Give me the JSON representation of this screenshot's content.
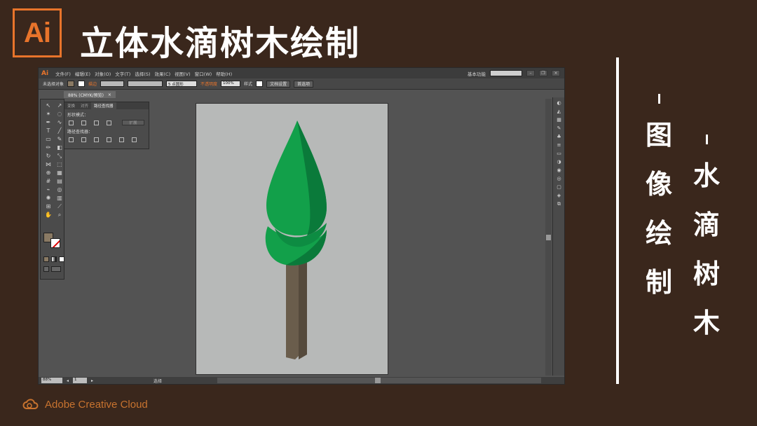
{
  "slide": {
    "logo_text": "Ai",
    "title": "立体水滴树木绘制",
    "column_a": [
      "图",
      "像",
      "绘",
      "制"
    ],
    "column_b": [
      "水",
      "滴",
      "树",
      "木"
    ],
    "footer_text": "Adobe Creative Cloud"
  },
  "app": {
    "menu": [
      "文件(F)",
      "编辑(E)",
      "对象(O)",
      "文字(T)",
      "选择(S)",
      "效果(C)",
      "视图(V)",
      "窗口(W)",
      "帮助(H)"
    ],
    "workspace_label": "基本功能",
    "control_bar": {
      "selection_label": "未选择对象",
      "stroke_label": "描边",
      "brush_label": "5 点圆形",
      "opacity_label": "不透明度",
      "opacity_value": "100%",
      "style_label": "样式",
      "doc_setup_button": "文档设置",
      "preferences_button": "首选项"
    },
    "doc_tab": {
      "title": "88% (CMYK/预览)",
      "close": "×"
    },
    "pathfinder": {
      "tabs": [
        "变换",
        "对齐",
        "路径查找器"
      ],
      "shape_modes_label": "形状模式：",
      "expand_label": "扩展",
      "pathfinders_label": "路径查找器："
    },
    "status": {
      "zoom": "88%",
      "page": "1",
      "tool_label": "选择"
    },
    "colors": {
      "tree_light": "#12a04a",
      "tree_dark": "#0a7a3a",
      "trunk_light": "#6a5d4c",
      "trunk_dark": "#554a3c",
      "fill_swatch": "#8a7a64"
    }
  }
}
